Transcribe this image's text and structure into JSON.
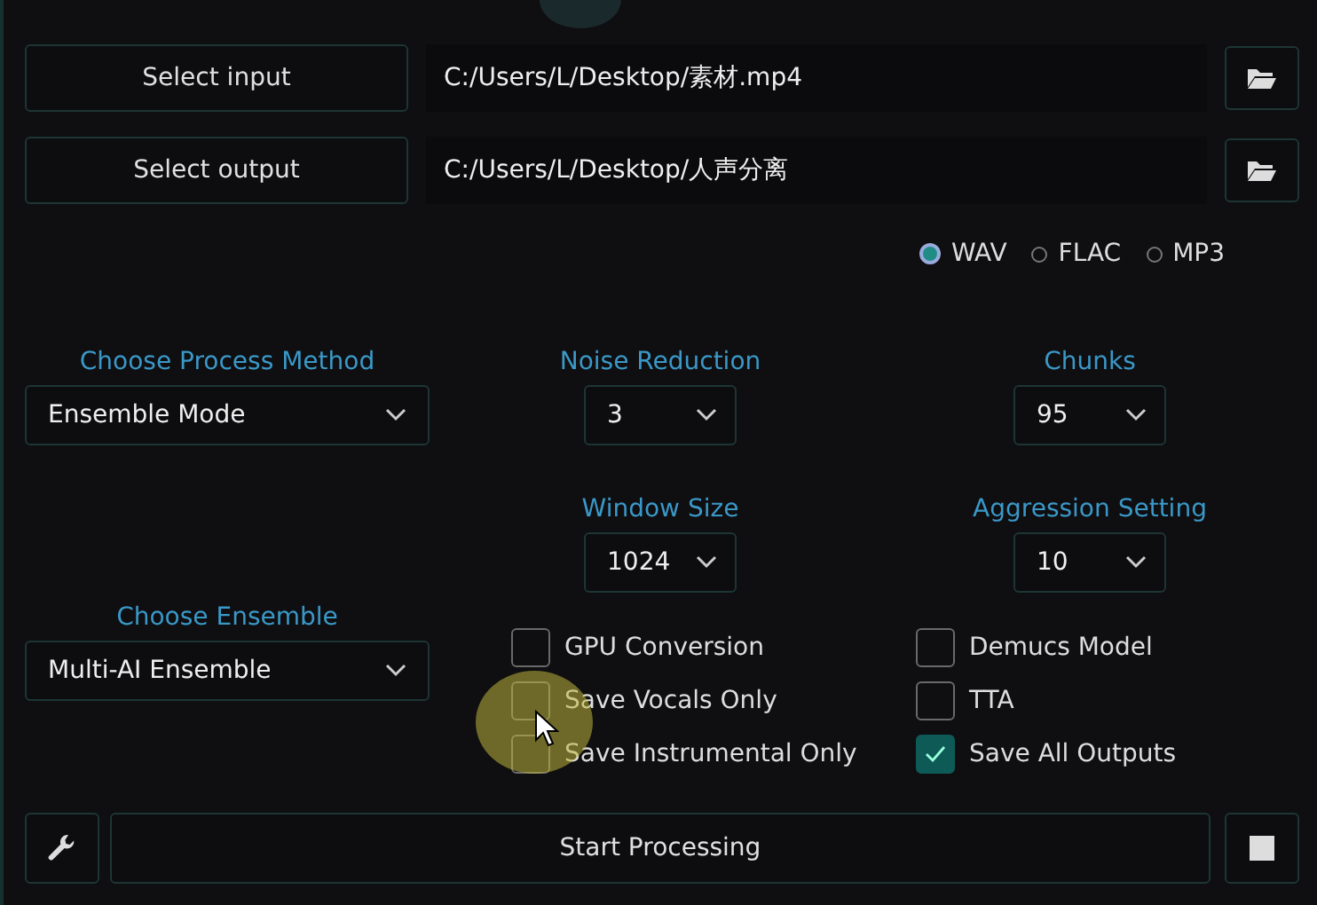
{
  "file_rows": [
    {
      "button": "Select input",
      "path": "C:/Users/L/Desktop/素材.mp4"
    },
    {
      "button": "Select output",
      "path": "C:/Users/L/Desktop/人声分离"
    }
  ],
  "formats": [
    {
      "label": "WAV",
      "selected": true
    },
    {
      "label": "FLAC",
      "selected": false
    },
    {
      "label": "MP3",
      "selected": false
    }
  ],
  "process_method": {
    "label": "Choose Process Method",
    "value": "Ensemble Mode"
  },
  "noise_reduction": {
    "label": "Noise Reduction",
    "value": "3"
  },
  "chunks": {
    "label": "Chunks",
    "value": "95"
  },
  "window_size": {
    "label": "Window Size",
    "value": "1024"
  },
  "aggression": {
    "label": "Aggression Setting",
    "value": "10"
  },
  "ensemble": {
    "label": "Choose Ensemble",
    "value": "Multi-AI Ensemble"
  },
  "options": [
    {
      "label": "GPU Conversion",
      "checked": false
    },
    {
      "label": "Demucs Model",
      "checked": false
    },
    {
      "label": "Save Vocals Only",
      "checked": false
    },
    {
      "label": "TTA",
      "checked": false
    },
    {
      "label": "Save Instrumental Only",
      "checked": false
    },
    {
      "label": "Save All Outputs",
      "checked": true
    }
  ],
  "start_button": "Start Processing"
}
